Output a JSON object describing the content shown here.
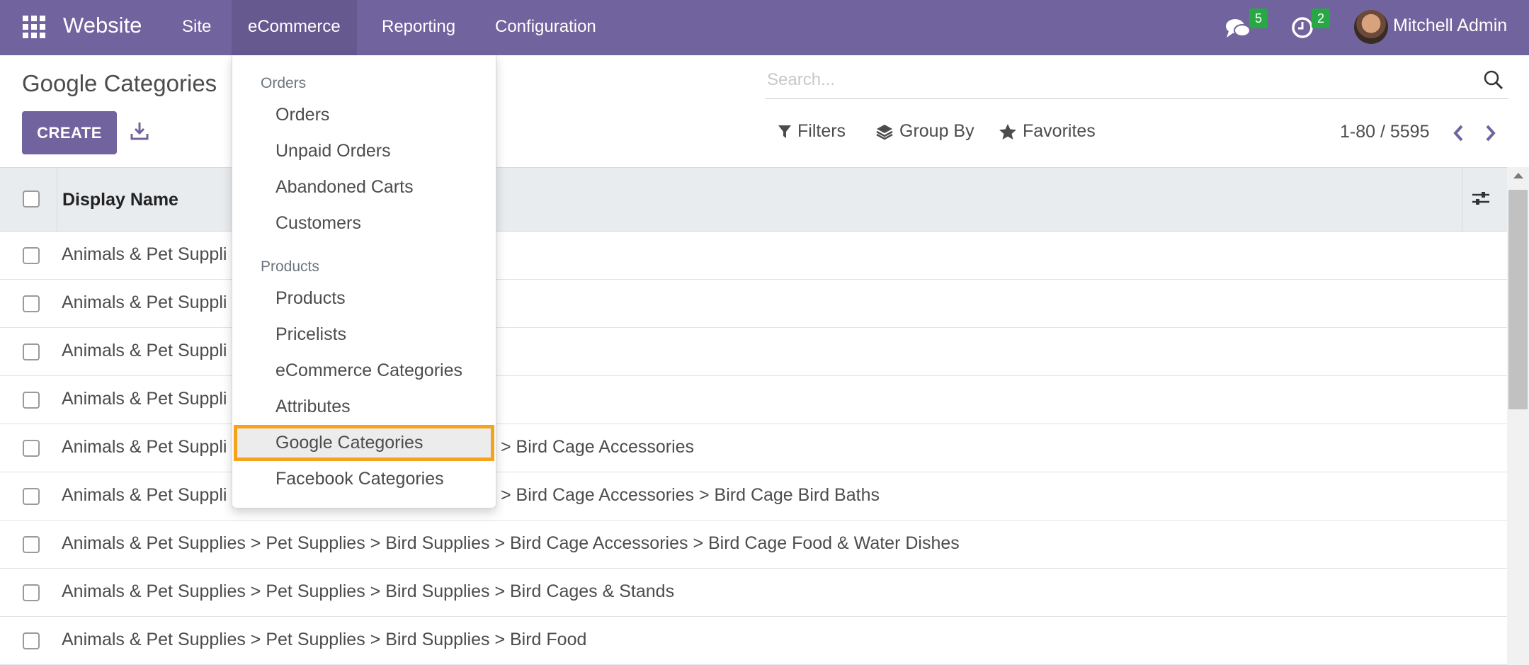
{
  "navbar": {
    "app_name": "Website",
    "menus": [
      "Site",
      "eCommerce",
      "Reporting",
      "Configuration"
    ],
    "messages_count": "5",
    "activities_count": "2",
    "user_name": "Mitchell Admin",
    "color": "#71639e"
  },
  "control_panel": {
    "title": "Google Categories",
    "create_label": "CREATE",
    "search_placeholder": "Search...",
    "filters_label": "Filters",
    "group_by_label": "Group By",
    "favorites_label": "Favorites",
    "pager_value": "1-80 / 5595"
  },
  "list": {
    "column_header": "Display Name",
    "rows": [
      "Animals & Pet Suppli",
      "Animals & Pet Suppli",
      "Animals & Pet Suppli",
      "Animals & Pet Suppli",
      "Animals & Pet Suppli",
      "Animals & Pet Suppli",
      "Animals & Pet Supplies > Pet Supplies > Bird Supplies > Bird Cage Accessories > Bird Cage Food & Water Dishes",
      "Animals & Pet Supplies > Pet Supplies > Bird Supplies > Bird Cages & Stands",
      "Animals & Pet Supplies > Pet Supplies > Bird Supplies > Bird Food"
    ],
    "row_tails": [
      "",
      "",
      "",
      "",
      "> Bird Cage Accessories",
      "> Bird Cage Accessories > Bird Cage Bird Baths",
      "",
      "",
      ""
    ]
  },
  "dropdown": {
    "orders_header": "Orders",
    "orders_items": [
      "Orders",
      "Unpaid Orders",
      "Abandoned Carts",
      "Customers"
    ],
    "products_header": "Products",
    "products_items": [
      "Products",
      "Pricelists",
      "eCommerce Categories",
      "Attributes",
      "Google Categories",
      "Facebook Categories"
    ],
    "highlight_color": "#f7a21b"
  }
}
